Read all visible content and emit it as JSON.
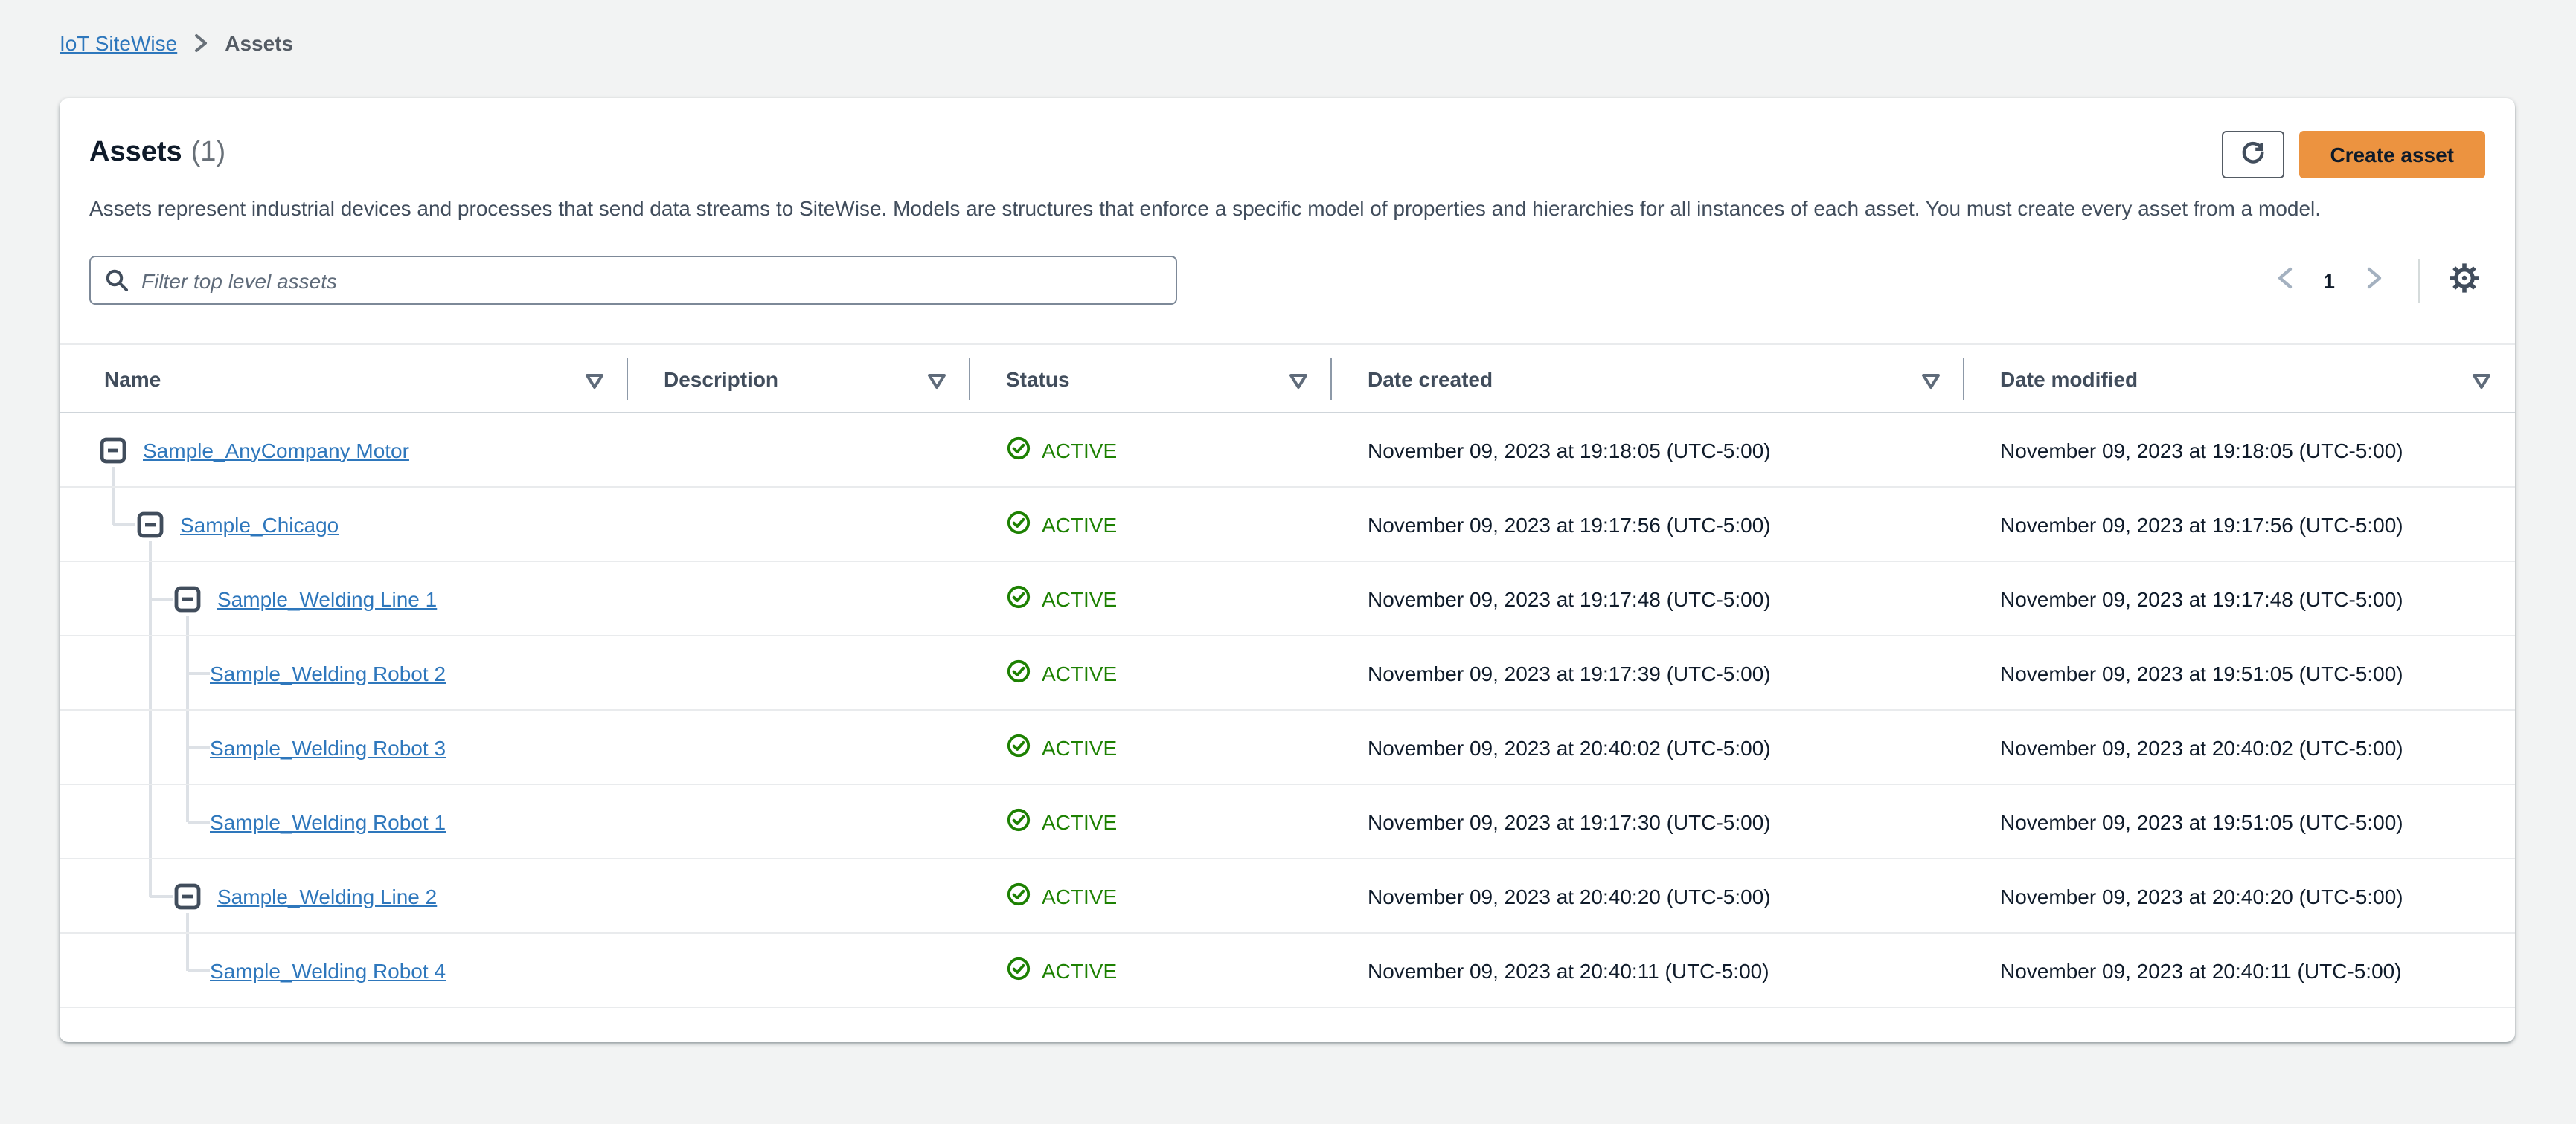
{
  "breadcrumb": {
    "items": [
      {
        "label": "IoT SiteWise",
        "type": "link"
      },
      {
        "label": "Assets",
        "type": "current"
      }
    ]
  },
  "header": {
    "title": "Assets",
    "count": "(1)",
    "description": "Assets represent industrial devices and processes that send data streams to SiteWise. Models are structures that enforce a specific model of properties and hierarchies for all instances of each asset. You must create every asset from a model.",
    "refresh_button": "refresh",
    "create_button_label": "Create asset"
  },
  "toolbar": {
    "filter_placeholder": "Filter top level assets",
    "pagination": {
      "current_page": "1",
      "prev": "previous-page",
      "next": "next-page"
    },
    "settings": "preferences"
  },
  "table": {
    "columns": [
      {
        "label": "Name"
      },
      {
        "label": "Description"
      },
      {
        "label": "Status"
      },
      {
        "label": "Date created"
      },
      {
        "label": "Date modified"
      }
    ],
    "rows": [
      {
        "name": "Sample_AnyCompany Motor",
        "level": 0,
        "expandable": true,
        "description": "",
        "status": "ACTIVE",
        "date_created": "November 09, 2023 at 19:18:05 (UTC-5:00)",
        "date_modified": "November 09, 2023 at 19:18:05 (UTC-5:00)"
      },
      {
        "name": "Sample_Chicago",
        "level": 1,
        "expandable": true,
        "description": "",
        "status": "ACTIVE",
        "date_created": "November 09, 2023 at 19:17:56 (UTC-5:00)",
        "date_modified": "November 09, 2023 at 19:17:56 (UTC-5:00)"
      },
      {
        "name": "Sample_Welding Line 1",
        "level": 2,
        "expandable": true,
        "description": "",
        "status": "ACTIVE",
        "date_created": "November 09, 2023 at 19:17:48 (UTC-5:00)",
        "date_modified": "November 09, 2023 at 19:17:48 (UTC-5:00)"
      },
      {
        "name": "Sample_Welding Robot 2",
        "level": 3,
        "expandable": false,
        "description": "",
        "status": "ACTIVE",
        "date_created": "November 09, 2023 at 19:17:39 (UTC-5:00)",
        "date_modified": "November 09, 2023 at 19:51:05 (UTC-5:00)"
      },
      {
        "name": "Sample_Welding Robot 3",
        "level": 3,
        "expandable": false,
        "description": "",
        "status": "ACTIVE",
        "date_created": "November 09, 2023 at 20:40:02 (UTC-5:00)",
        "date_modified": "November 09, 2023 at 20:40:02 (UTC-5:00)"
      },
      {
        "name": "Sample_Welding Robot 1",
        "level": 3,
        "expandable": false,
        "description": "",
        "status": "ACTIVE",
        "date_created": "November 09, 2023 at 19:17:30 (UTC-5:00)",
        "date_modified": "November 09, 2023 at 19:51:05 (UTC-5:00)"
      },
      {
        "name": "Sample_Welding Line 2",
        "level": 2,
        "expandable": true,
        "description": "",
        "status": "ACTIVE",
        "date_created": "November 09, 2023 at 20:40:20 (UTC-5:00)",
        "date_modified": "November 09, 2023 at 20:40:20 (UTC-5:00)"
      },
      {
        "name": "Sample_Welding Robot 4",
        "level": 3,
        "expandable": false,
        "description": "",
        "status": "ACTIVE",
        "date_created": "November 09, 2023 at 20:40:11 (UTC-5:00)",
        "date_modified": "November 09, 2023 at 20:40:11 (UTC-5:00)"
      }
    ]
  },
  "colors": {
    "page_background": "#f2f3f3",
    "primary_button_bg": "#ec9340",
    "link_blue": "#2e77bc",
    "status_active_green": "#1d8102"
  }
}
